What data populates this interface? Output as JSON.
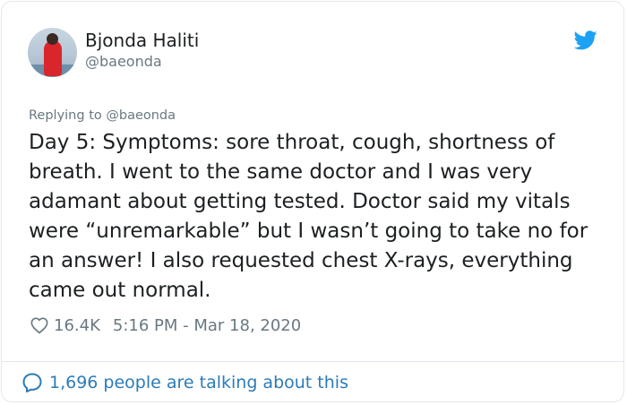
{
  "tweet": {
    "author_name": "Bjonda Haliti",
    "author_handle": "@baeonda",
    "replying_prefix": "Replying to",
    "replying_to": "@baeonda",
    "text": "Day 5: Symptoms: sore throat, cough, shortness of breath. I went to the same doctor and I was very adamant about getting tested. Doctor said my vitals were “unremarkable” but I wasn’t going to take no for an answer! I also requested chest X-rays, everything came out normal.",
    "like_count": "16.4K",
    "timestamp": "5:16 PM - Mar 18, 2020",
    "conversation_text": "1,696 people are talking about this"
  },
  "icons": {
    "brand": "twitter-bird-icon",
    "like": "heart-icon",
    "conversation": "speech-bubble-icon"
  },
  "colors": {
    "brand_blue": "#1da1f2",
    "link_blue": "#2b7bb9",
    "secondary_text": "#697882",
    "primary_text": "#1c2022",
    "border": "#e1e8ed"
  }
}
